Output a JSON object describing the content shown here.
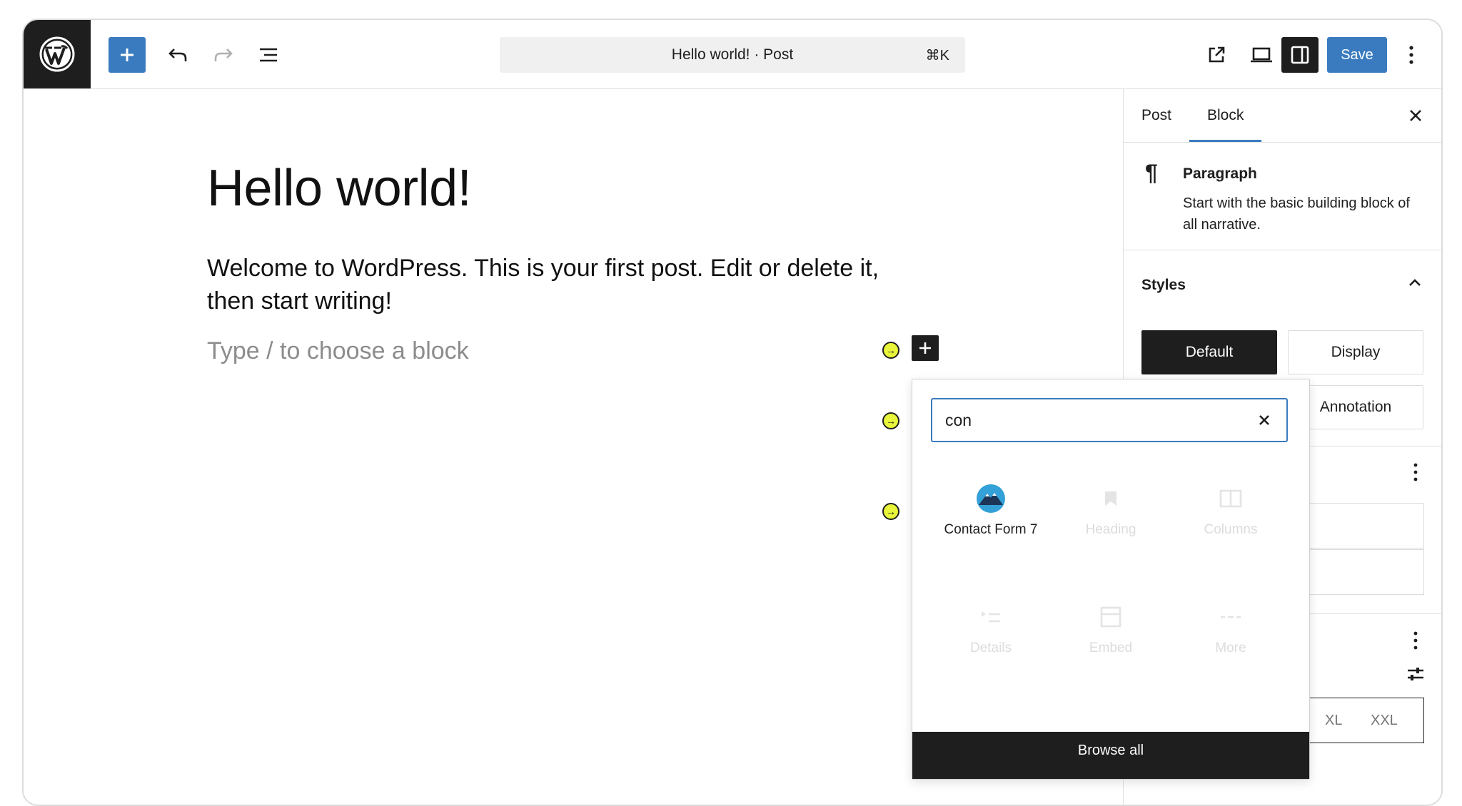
{
  "topbar": {
    "command_bar_title": "Hello world! · Post",
    "command_shortcut": "⌘K",
    "save_label": "Save"
  },
  "editor": {
    "title": "Hello world!",
    "paragraph": "Welcome to WordPress. This is your first post. Edit or delete it, then start writing!",
    "placeholder": "Type / to choose a block"
  },
  "quick_inserter": {
    "search_value": "con",
    "results": [
      {
        "label": "Contact Form 7",
        "icon": "contact-form-7-icon",
        "faded": false
      },
      {
        "label": "Heading",
        "icon": "heading-icon",
        "faded": true
      },
      {
        "label": "Columns",
        "icon": "columns-icon",
        "faded": true
      },
      {
        "label": "Details",
        "icon": "details-icon",
        "faded": true
      },
      {
        "label": "Embed",
        "icon": "embed-icon",
        "faded": true
      },
      {
        "label": "More",
        "icon": "more-icon",
        "faded": true
      }
    ],
    "browse_all_label": "Browse all"
  },
  "sidebar": {
    "tabs": [
      {
        "label": "Post",
        "active": false
      },
      {
        "label": "Block",
        "active": true
      }
    ],
    "block_card": {
      "title": "Paragraph",
      "description": "Start with the basic building block of all narrative."
    },
    "styles": {
      "title": "Styles",
      "options": [
        {
          "label": "Default",
          "selected": true
        },
        {
          "label": "Display",
          "selected": false
        },
        {
          "label": "",
          "selected": false
        },
        {
          "label": "Annotation",
          "selected": false
        }
      ]
    },
    "size_options": [
      "XL",
      "XXL"
    ]
  },
  "colors": {
    "accent": "#3a7bbf",
    "dark": "#1e1e1e",
    "marker": "#e8f53a"
  }
}
